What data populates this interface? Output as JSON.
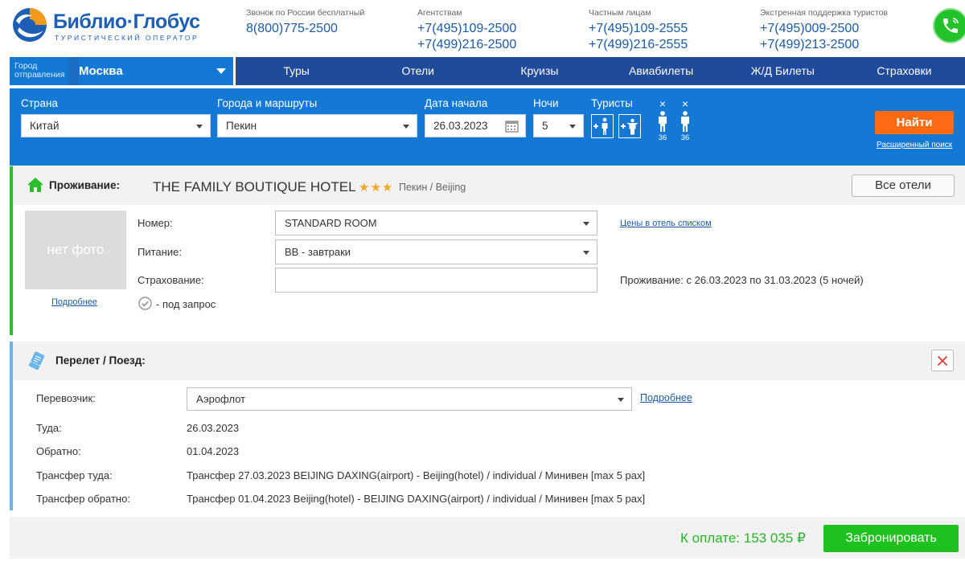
{
  "brand": {
    "name": "Библио·Глобус",
    "tagline": "ТУРИСТИЧЕСКИЙ ОПЕРАТОР"
  },
  "contacts": [
    {
      "label": "Звонок по России бесплатный",
      "phones": [
        "8(800)775-2500"
      ]
    },
    {
      "label": "Агентствам",
      "phones": [
        "+7(495)109-2500",
        "+7(499)216-2500"
      ]
    },
    {
      "label": "Частным лицам",
      "phones": [
        "+7(495)109-2555",
        "+7(499)216-2555"
      ]
    },
    {
      "label": "Экстренная поддержка туристов",
      "phones": [
        "+7(495)009-2500",
        "+7(499)213-2500"
      ]
    }
  ],
  "nav": {
    "city_label_1": "Город",
    "city_label_2": "отправления",
    "city": "Москва",
    "menu": [
      "Туры",
      "Отели",
      "Круизы",
      "Авиабилеты",
      "Ж/Д Билеты",
      "Страховки"
    ]
  },
  "search": {
    "country_label": "Страна",
    "country": "Китай",
    "route_label": "Города и маршруты",
    "route": "Пекин",
    "date_label": "Дата начала",
    "date": "26.03.2023",
    "nights_label": "Ночи",
    "nights": "5",
    "tourists_label": "Туристы",
    "tourist_remove": "×",
    "tourist_ages": [
      "36",
      "36"
    ],
    "find_label": "Найти",
    "advanced_label": "Расширенный поиск"
  },
  "hotel": {
    "section_title": "Проживание:",
    "name": "THE FAMILY BOUTIQUE HOTEL",
    "stars": "★★★",
    "city": "Пекин / Beijing",
    "all_hotels": "Все отели",
    "no_photo": "нет фото",
    "more_link": "Подробнее",
    "room_label": "Номер:",
    "room": "STANDARD ROOM",
    "meal_label": "Питание:",
    "meal": "BB  - завтраки",
    "insurance_label": "Страхование:",
    "insurance": "",
    "on_request": "- под запрос",
    "prices_link": "Цены в отель списком",
    "stay_info": "Проживание: с 26.03.2023 по 31.03.2023 (5 ночей)"
  },
  "flight": {
    "section_title": "Перелет / Поезд:",
    "carrier_label": "Перевозчик:",
    "carrier": "Аэрофлот",
    "more_link": "Подробнее",
    "rows": [
      {
        "label": "Туда:",
        "value": "26.03.2023"
      },
      {
        "label": "Обратно:",
        "value": "01.04.2023"
      },
      {
        "label": "Трансфер туда:",
        "value": "Трансфер 27.03.2023 BEIJING DAXING(airport) - Beijing(hotel) / individual / Минивен [max 5 pax]"
      },
      {
        "label": "Трансфер обратно:",
        "value": "Трансфер 01.04.2023 Beijing(hotel) - BEIJING DAXING(airport) / individual / Минивен [max 5 pax]"
      }
    ]
  },
  "footer": {
    "total": "К оплате: 153 035 ₽",
    "book_label": "Забронировать"
  },
  "colors": {
    "brand_blue": "#1479d4",
    "nav_dark": "#1f4b9a",
    "accent_orange": "#ff6a13",
    "success_green": "#1ec11e"
  }
}
